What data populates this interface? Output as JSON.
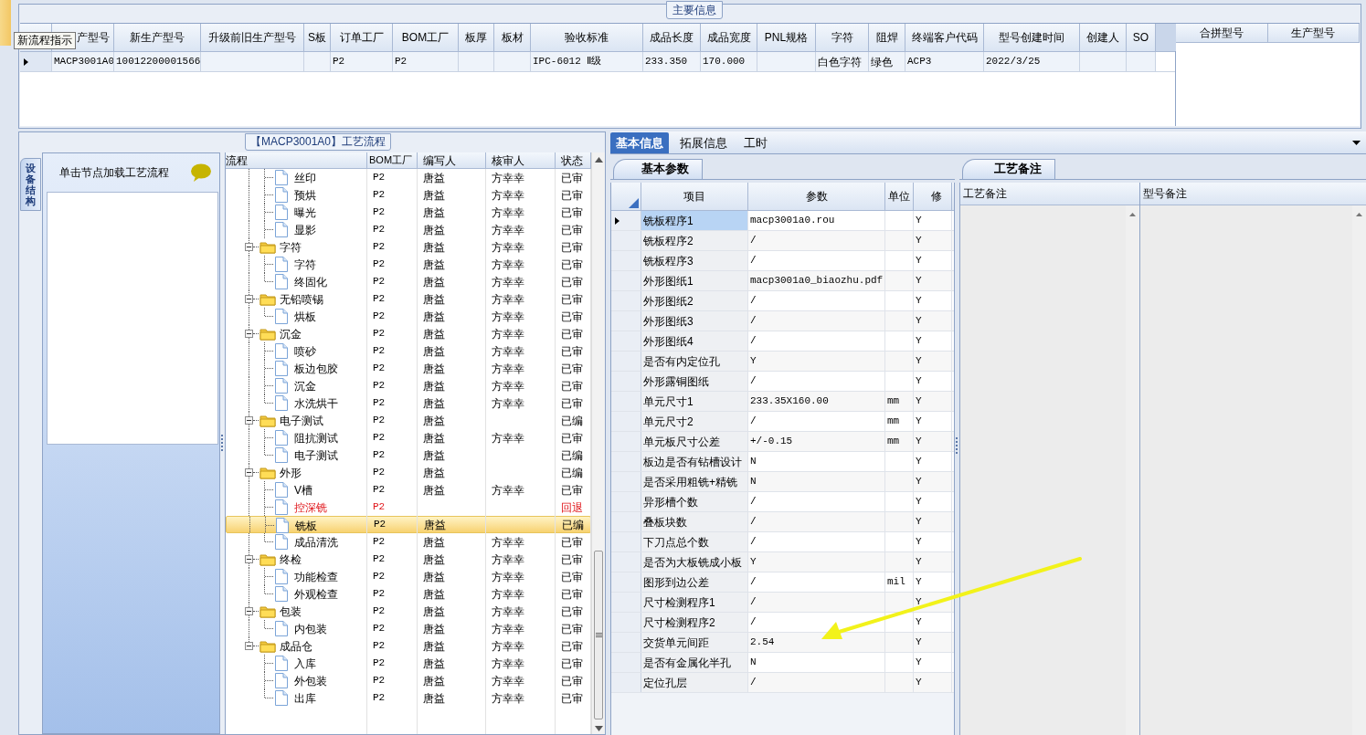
{
  "main_info": {
    "title": "主要信息",
    "columns": [
      "产型号",
      "新生产型号",
      "升级前旧生产型号",
      "S板",
      "订单工厂",
      "BOM工厂",
      "板厚",
      "板材",
      "验收标准",
      "成品长度",
      "成品宽度",
      "PNL规格",
      "字符",
      "阻焊",
      "终端客户代码",
      "型号创建时间",
      "创建人",
      "SO"
    ],
    "rows": [
      {
        "selected": true,
        "cells": [
          "MACP3001A0",
          "10012200001566",
          null,
          null,
          "P2",
          "P2",
          null,
          null,
          "IPC-6012 Ⅱ级",
          "233.350",
          "170.000",
          null,
          "白色字符",
          "绿色",
          "ACP3",
          "2022/3/25",
          null,
          null
        ]
      }
    ]
  },
  "tooltip": "新流程指示",
  "merge_grid": {
    "columns": [
      "合拼型号",
      "生产型号"
    ]
  },
  "process_panel": {
    "title": "【MACP3001A0】工艺流程",
    "side_tab": "设备结构",
    "hint": "单击节点加载工艺流程",
    "tree_columns": [
      "流程",
      "BOM工厂",
      "编写人",
      "核审人",
      "状态"
    ],
    "tree": [
      {
        "kind": "leaf",
        "label": "丝印",
        "bom": "P2",
        "writer": "唐益",
        "reviewer": "方幸幸",
        "status": "已审",
        "rejected": false,
        "selected": false
      },
      {
        "kind": "leaf",
        "label": "预烘",
        "bom": "P2",
        "writer": "唐益",
        "reviewer": "方幸幸",
        "status": "已审",
        "rejected": false,
        "selected": false
      },
      {
        "kind": "leaf",
        "label": "曝光",
        "bom": "P2",
        "writer": "唐益",
        "reviewer": "方幸幸",
        "status": "已审",
        "rejected": false,
        "selected": false
      },
      {
        "kind": "leaf",
        "label": "显影",
        "bom": "P2",
        "writer": "唐益",
        "reviewer": "方幸幸",
        "status": "已审",
        "rejected": false,
        "selected": false
      },
      {
        "kind": "folder",
        "label": "字符",
        "bom": "P2",
        "writer": "唐益",
        "reviewer": "方幸幸",
        "status": "已审",
        "rejected": false,
        "selected": false,
        "expanded": true,
        "children": [
          {
            "kind": "leaf",
            "label": "字符",
            "bom": "P2",
            "writer": "唐益",
            "reviewer": "方幸幸",
            "status": "已审",
            "rejected": false,
            "selected": false
          },
          {
            "kind": "leaf",
            "label": "终固化",
            "bom": "P2",
            "writer": "唐益",
            "reviewer": "方幸幸",
            "status": "已审",
            "rejected": false,
            "selected": false
          }
        ]
      },
      {
        "kind": "folder",
        "label": "无铅喷锡",
        "bom": "P2",
        "writer": "唐益",
        "reviewer": "方幸幸",
        "status": "已审",
        "rejected": false,
        "selected": false,
        "expanded": true,
        "children": [
          {
            "kind": "leaf",
            "label": "烘板",
            "bom": "P2",
            "writer": "唐益",
            "reviewer": "方幸幸",
            "status": "已审",
            "rejected": false,
            "selected": false
          }
        ]
      },
      {
        "kind": "folder",
        "label": "沉金",
        "bom": "P2",
        "writer": "唐益",
        "reviewer": "方幸幸",
        "status": "已审",
        "rejected": false,
        "selected": false,
        "expanded": true,
        "children": [
          {
            "kind": "leaf",
            "label": "喷砂",
            "bom": "P2",
            "writer": "唐益",
            "reviewer": "方幸幸",
            "status": "已审",
            "rejected": false,
            "selected": false
          },
          {
            "kind": "leaf",
            "label": "板边包胶",
            "bom": "P2",
            "writer": "唐益",
            "reviewer": "方幸幸",
            "status": "已审",
            "rejected": false,
            "selected": false
          },
          {
            "kind": "leaf",
            "label": "沉金",
            "bom": "P2",
            "writer": "唐益",
            "reviewer": "方幸幸",
            "status": "已审",
            "rejected": false,
            "selected": false
          },
          {
            "kind": "leaf",
            "label": "水洗烘干",
            "bom": "P2",
            "writer": "唐益",
            "reviewer": "方幸幸",
            "status": "已审",
            "rejected": false,
            "selected": false
          }
        ]
      },
      {
        "kind": "folder",
        "label": "电子测试",
        "bom": "P2",
        "writer": "唐益",
        "status": "已编",
        "rejected": false,
        "selected": false,
        "expanded": true,
        "children": [
          {
            "kind": "leaf",
            "label": "阻抗测试",
            "bom": "P2",
            "writer": "唐益",
            "reviewer": "方幸幸",
            "status": "已审",
            "rejected": false,
            "selected": false
          },
          {
            "kind": "leaf",
            "label": "电子测试",
            "bom": "P2",
            "writer": "唐益",
            "status": "已编",
            "rejected": false,
            "selected": false
          }
        ]
      },
      {
        "kind": "folder",
        "label": "外形",
        "bom": "P2",
        "writer": "唐益",
        "status": "已编",
        "rejected": false,
        "selected": false,
        "expanded": true,
        "children": [
          {
            "kind": "leaf",
            "label": "V槽",
            "bom": "P2",
            "writer": "唐益",
            "reviewer": "方幸幸",
            "status": "已审",
            "rejected": false,
            "selected": false
          },
          {
            "kind": "leaf",
            "label": "控深铣",
            "bom": "P2",
            "status": "回退",
            "rejected": true,
            "selected": false
          },
          {
            "kind": "leaf",
            "label": "铣板",
            "bom": "P2",
            "writer": "唐益",
            "status": "已编",
            "rejected": false,
            "selected": true
          },
          {
            "kind": "leaf",
            "label": "成品清洗",
            "bom": "P2",
            "writer": "唐益",
            "reviewer": "方幸幸",
            "status": "已审",
            "rejected": false,
            "selected": false
          }
        ]
      },
      {
        "kind": "folder",
        "label": "终检",
        "bom": "P2",
        "writer": "唐益",
        "reviewer": "方幸幸",
        "status": "已审",
        "rejected": false,
        "selected": false,
        "expanded": true,
        "children": [
          {
            "kind": "leaf",
            "label": "功能检查",
            "bom": "P2",
            "writer": "唐益",
            "reviewer": "方幸幸",
            "status": "已审",
            "rejected": false,
            "selected": false
          },
          {
            "kind": "leaf",
            "label": "外观检查",
            "bom": "P2",
            "writer": "唐益",
            "reviewer": "方幸幸",
            "status": "已审",
            "rejected": false,
            "selected": false
          }
        ]
      },
      {
        "kind": "folder",
        "label": "包装",
        "bom": "P2",
        "writer": "唐益",
        "reviewer": "方幸幸",
        "status": "已审",
        "rejected": false,
        "selected": false,
        "expanded": true,
        "children": [
          {
            "kind": "leaf",
            "label": "内包装",
            "bom": "P2",
            "writer": "唐益",
            "reviewer": "方幸幸",
            "status": "已审",
            "rejected": false,
            "selected": false
          }
        ]
      },
      {
        "kind": "folder",
        "label": "成品仓",
        "bom": "P2",
        "writer": "唐益",
        "reviewer": "方幸幸",
        "status": "已审",
        "rejected": false,
        "selected": false,
        "expanded": true,
        "children": [
          {
            "kind": "leaf",
            "label": "入库",
            "bom": "P2",
            "writer": "唐益",
            "reviewer": "方幸幸",
            "status": "已审",
            "rejected": false,
            "selected": false
          },
          {
            "kind": "leaf",
            "label": "外包装",
            "bom": "P2",
            "writer": "唐益",
            "reviewer": "方幸幸",
            "status": "已审",
            "rejected": false,
            "selected": false
          },
          {
            "kind": "leaf",
            "label": "出库",
            "bom": "P2",
            "writer": "唐益",
            "reviewer": "方幸幸",
            "status": "已审",
            "rejected": false,
            "selected": false
          }
        ]
      }
    ]
  },
  "detail_tabs": [
    {
      "label": "基本信息",
      "selected": true
    },
    {
      "label": "拓展信息",
      "selected": false
    },
    {
      "label": "工时",
      "selected": false
    }
  ],
  "params": {
    "tab": "基本参数",
    "columns": [
      "项目",
      "参数",
      "单位",
      "修"
    ],
    "rows": [
      {
        "item": "铣板程序1",
        "value": "macp3001a0.rou",
        "modified": "Y",
        "selected": true
      },
      {
        "item": "铣板程序2",
        "value": "/",
        "modified": "Y",
        "selected": false
      },
      {
        "item": "铣板程序3",
        "value": "/",
        "modified": "Y",
        "selected": false
      },
      {
        "item": "外形图纸1",
        "value": "macp3001a0_biaozhu.pdf",
        "modified": "Y",
        "selected": false
      },
      {
        "item": "外形图纸2",
        "value": "/",
        "modified": "Y",
        "selected": false
      },
      {
        "item": "外形图纸3",
        "value": "/",
        "modified": "Y",
        "selected": false
      },
      {
        "item": "外形图纸4",
        "value": "/",
        "modified": "Y",
        "selected": false
      },
      {
        "item": "是否有内定位孔",
        "value": "Y",
        "modified": "Y",
        "selected": false
      },
      {
        "item": "外形露铜图纸",
        "value": "/",
        "modified": "Y",
        "selected": false
      },
      {
        "item": "单元尺寸1",
        "value": "233.35X160.00",
        "unit": "mm",
        "modified": "Y",
        "selected": false
      },
      {
        "item": "单元尺寸2",
        "value": "/",
        "unit": "mm",
        "modified": "Y",
        "selected": false
      },
      {
        "item": "单元板尺寸公差",
        "value": "+/-0.15",
        "unit": "mm",
        "modified": "Y",
        "selected": false
      },
      {
        "item": "板边是否有钻槽设计",
        "value": "N",
        "modified": "Y",
        "selected": false
      },
      {
        "item": "是否采用粗铣+精铣",
        "value": "N",
        "modified": "Y",
        "selected": false
      },
      {
        "item": "异形槽个数",
        "value": "/",
        "modified": "Y",
        "selected": false
      },
      {
        "item": "叠板块数",
        "value": "/",
        "modified": "Y",
        "selected": false
      },
      {
        "item": "下刀点总个数",
        "value": "/",
        "modified": "Y",
        "selected": false
      },
      {
        "item": "是否为大板铣成小板",
        "value": "Y",
        "modified": "Y",
        "selected": false
      },
      {
        "item": "图形到边公差",
        "value": "/",
        "unit": "mil",
        "modified": "Y",
        "selected": false
      },
      {
        "item": "尺寸检测程序1",
        "value": "/",
        "modified": "Y",
        "selected": false
      },
      {
        "item": "尺寸检测程序2",
        "value": "/",
        "modified": "Y",
        "selected": false
      },
      {
        "item": "交货单元间距",
        "value": "2.54",
        "modified": "Y",
        "selected": false
      },
      {
        "item": "是否有金属化半孔",
        "value": "N",
        "modified": "Y",
        "selected": false
      },
      {
        "item": "定位孔层",
        "value": "/",
        "modified": "Y",
        "selected": false
      }
    ]
  },
  "notes": {
    "tab": "工艺备注",
    "columns": [
      "工艺备注",
      "型号备注"
    ]
  }
}
